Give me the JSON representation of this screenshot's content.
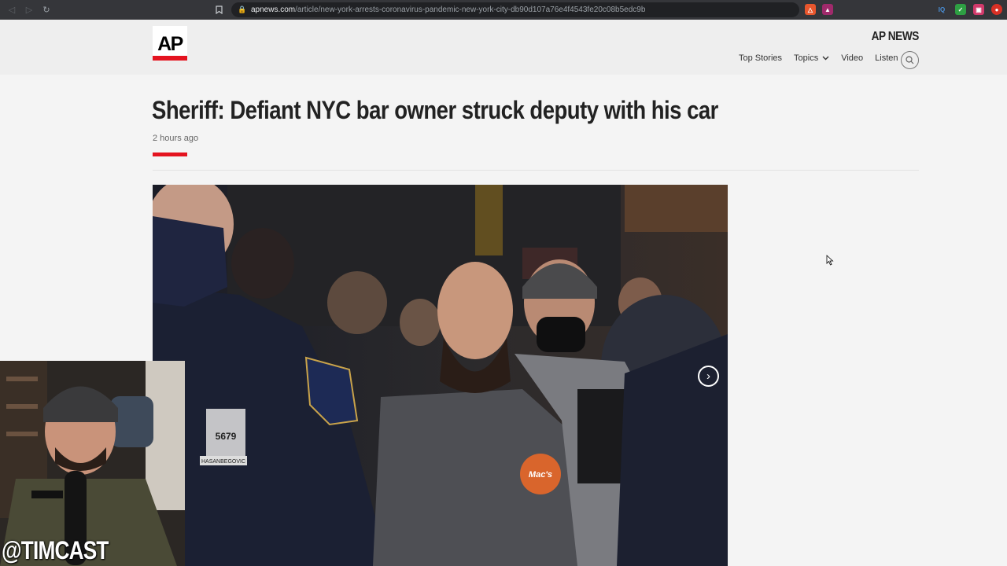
{
  "browser": {
    "url_domain": "apnews.com",
    "url_path": "/article/new-york-arrests-coronavirus-pandemic-new-york-city-db90d107a76e4f4543fe20c08b5edc9b"
  },
  "site": {
    "logo_text": "AP",
    "brand": "AP NEWS",
    "nav": [
      "Top Stories",
      "Topics",
      "Video",
      "Listen"
    ],
    "accent_color": "#e4131f"
  },
  "article": {
    "headline": "Sheriff: Defiant NYC bar owner struck deputy with his car",
    "timestamp": "2 hours ago"
  },
  "photo": {
    "badge_text": "5679",
    "name_tag": "HASANBEGOVIC",
    "shirt_logo": "Mac's"
  },
  "overlay": {
    "handle": "@TIMCAST"
  },
  "icons": [
    "back-icon",
    "forward-icon",
    "reload-icon",
    "bookmark-icon",
    "lock-icon",
    "search-icon",
    "chevron-down-icon",
    "next-arrow-icon",
    "cursor-icon"
  ]
}
